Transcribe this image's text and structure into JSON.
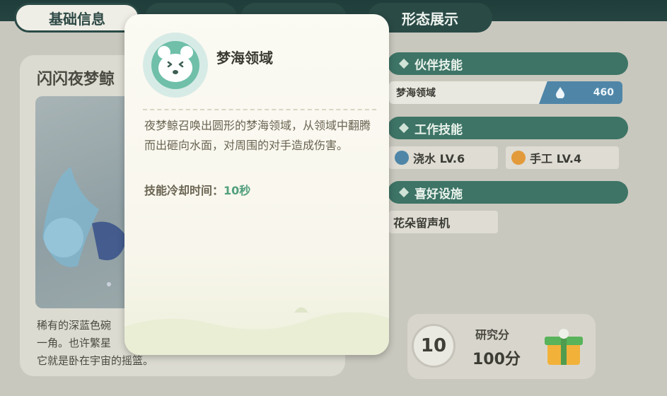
{
  "tabs": {
    "basic": "基础信息",
    "form": "形态展示"
  },
  "creature": {
    "name": "闪闪夜梦鲸",
    "description_lines": [
      "稀有的深蓝色碗",
      "一角。也许繁星",
      "它就是卧在宇宙的摇篮。"
    ]
  },
  "sections": {
    "partner_skill": "伙伴技能",
    "work_skill": "工作技能",
    "favorite_facility": "喜好设施"
  },
  "partner_skill": {
    "name": "梦海领域",
    "cost": "460"
  },
  "work_skills": [
    {
      "label": "浇水 LV.6"
    },
    {
      "label": "手工 LV.4"
    }
  ],
  "facility": {
    "label": "花朵留声机"
  },
  "research": {
    "level": "10",
    "label": "研究分",
    "score": "100分"
  },
  "popup": {
    "title": "梦海领域",
    "description": "夜梦鲸召唤出圆形的梦海领域，从领域中翻腾而出砸向水面，对周围的对手造成伤害。",
    "cooldown_label": "技能冷却时间：",
    "cooldown_value": "10秒"
  },
  "colors": {
    "accent_green": "#3d7466",
    "tab_dark": "#2a4a46",
    "skill_blue": "#4f86a8",
    "cooldown_green": "#52a07d"
  }
}
